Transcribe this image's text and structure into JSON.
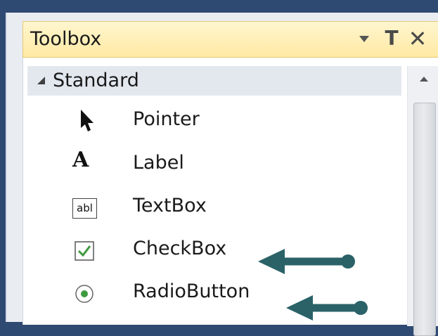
{
  "toolbox": {
    "title": "Toolbox",
    "pin_glyph": "Τ",
    "close_glyph": "✕",
    "category": "Standard",
    "items": [
      {
        "label": "Pointer",
        "icon": "pointer-icon"
      },
      {
        "label": "Label",
        "icon": "label-icon",
        "icon_text": "A"
      },
      {
        "label": "TextBox",
        "icon": "textbox-icon",
        "icon_text": "abl"
      },
      {
        "label": "CheckBox",
        "icon": "checkbox-icon"
      },
      {
        "label": "RadioButton",
        "icon": "radiobutton-icon"
      }
    ]
  },
  "colors": {
    "titlebar": "#ffe9a3",
    "annotation_arrow": "#1f5a60",
    "checkbox_green": "#3e9a3e"
  }
}
